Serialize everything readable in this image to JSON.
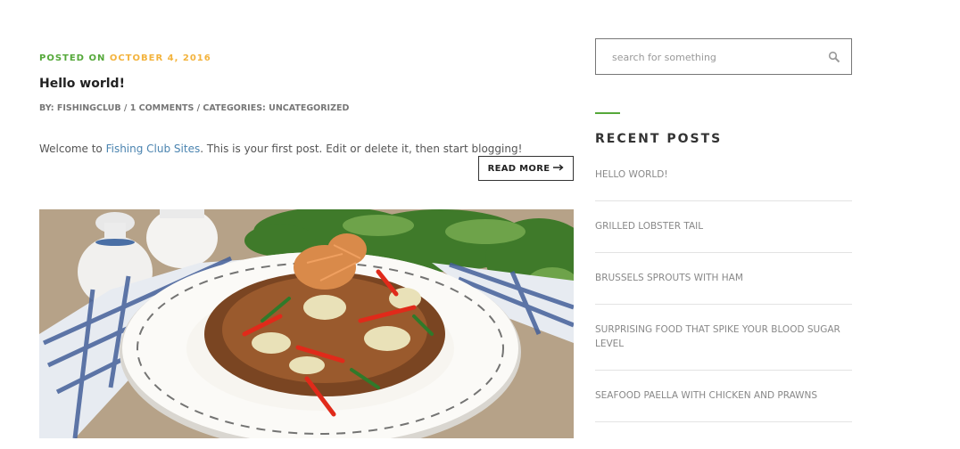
{
  "post": {
    "posted_label": "POSTED ON",
    "posted_date": "OCTOBER 4, 2016",
    "title": "Hello world!",
    "byline": "BY: FISHINGCLUB / 1 COMMENTS / CATEGORIES: UNCATEGORIZED",
    "excerpt_before": "Welcome to ",
    "excerpt_link": "Fishing Club Sites",
    "excerpt_after": ". This is your first post. Edit or delete it, then start blogging!",
    "read_more_label": "READ MORE",
    "read_more_icon": "long-arrow-right-icon",
    "image_subject": "glass noodle stir-fry dish"
  },
  "sidebar": {
    "search": {
      "placeholder": "search for something",
      "value": "",
      "icon": "search-icon"
    },
    "recent_posts": {
      "title": "RECENT POSTS",
      "items": [
        "HELLO WORLD!",
        "GRILLED LOBSTER TAIL",
        "BRUSSELS SPROUTS WITH HAM",
        "SURPRISING FOOD THAT SPIKE YOUR BLOOD SUGAR LEVEL",
        "SEAFOOD PAELLA WITH CHICKEN AND PRAWNS"
      ]
    }
  },
  "colors": {
    "accent_green": "#55a83a",
    "date_orange": "#f3b33d",
    "link_blue": "#4b84b0"
  }
}
